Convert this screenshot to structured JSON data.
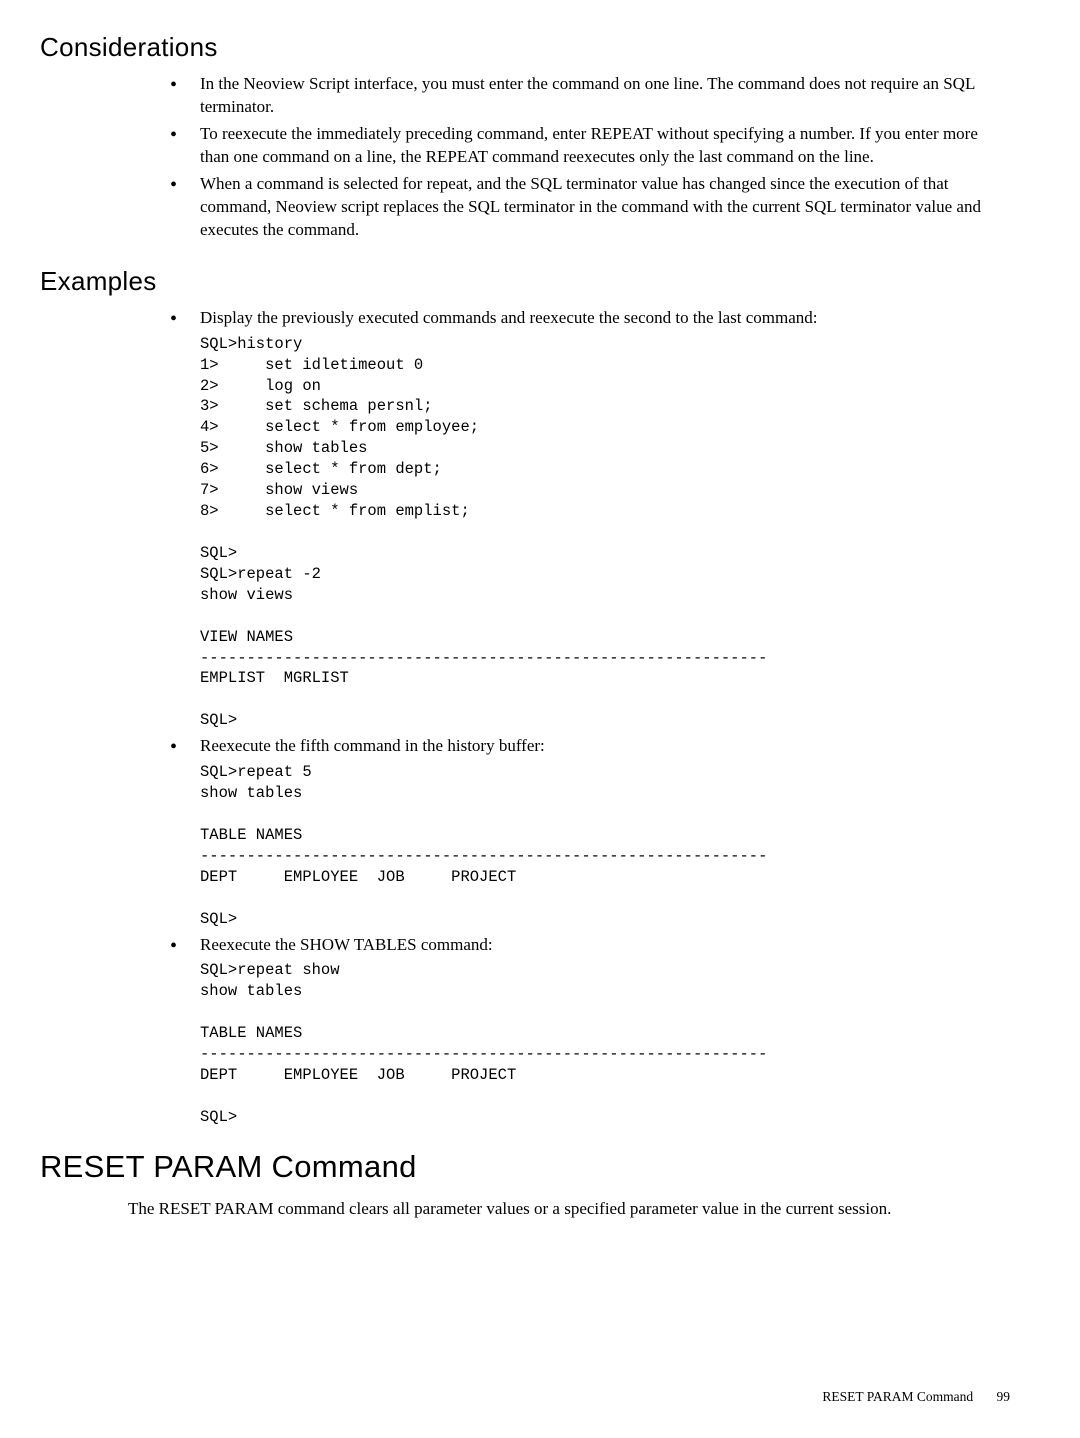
{
  "considerations": {
    "heading": "Considerations",
    "items": [
      "In the Neoview Script interface, you must enter the command on one line. The command does not require an SQL terminator.",
      "To reexecute the immediately preceding command, enter REPEAT without specifying a number. If you enter more than one command on a line, the REPEAT command reexecutes only the last command on the line.",
      "When a command is selected for repeat, and the SQL terminator value has changed since the execution of that command, Neoview script replaces the SQL terminator in the command with the current SQL terminator value and executes the command."
    ]
  },
  "examples": {
    "heading": "Examples",
    "items": [
      {
        "text": "Display the previously executed commands and reexecute the second to the last command:",
        "code": "SQL>history\n1>     set idletimeout 0\n2>     log on\n3>     set schema persnl;\n4>     select * from employee;\n5>     show tables\n6>     select * from dept;\n7>     show views\n8>     select * from emplist;\n\nSQL>\nSQL>repeat -2\nshow views\n\nVIEW NAMES\n-------------------------------------------------------------\nEMPLIST  MGRLIST\n\nSQL>"
      },
      {
        "text": "Reexecute the fifth command in the history buffer:",
        "code": "SQL>repeat 5\nshow tables\n\nTABLE NAMES\n-------------------------------------------------------------\nDEPT     EMPLOYEE  JOB     PROJECT\n\nSQL>"
      },
      {
        "text": "Reexecute the SHOW TABLES command:",
        "code": "SQL>repeat show\nshow tables\n\nTABLE NAMES\n-------------------------------------------------------------\nDEPT     EMPLOYEE  JOB     PROJECT\n\nSQL>"
      }
    ]
  },
  "reset_param": {
    "heading": "RESET PARAM Command",
    "body": "The RESET PARAM command clears all parameter values or a specified parameter value in the current session."
  },
  "footer": {
    "label": "RESET PARAM Command",
    "page": "99"
  }
}
